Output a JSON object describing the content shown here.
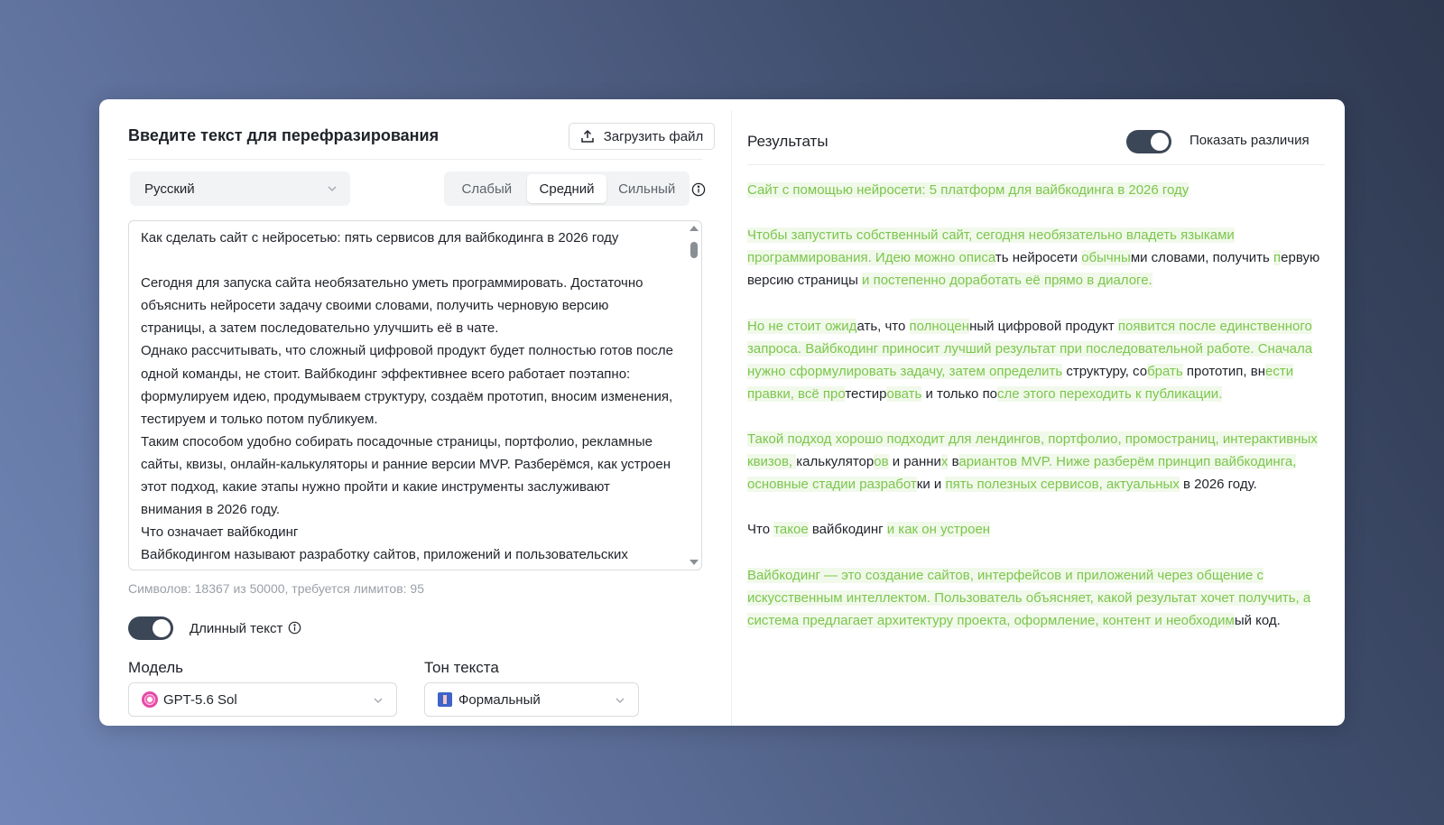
{
  "input": {
    "title": "Введите текст для перефразирования",
    "upload_label": "Загрузить файл",
    "language": "Русский",
    "strength_options": [
      "Слабый",
      "Средний",
      "Сильный"
    ],
    "strength_selected": "Средний",
    "text": "Как сделать сайт с нейросетью: пять сервисов для вайбкодинга в 2026 году\n\nСегодня для запуска сайта необязательно уметь программировать. Достаточно объяснить нейросети задачу своими словами, получить черновую версию страницы, а затем последовательно улучшить её в чате.\nОднако рассчитывать, что сложный цифровой продукт будет полностью готов после одной команды, не стоит. Вайбкодинг эффективнее всего работает поэтапно: формулируем идею, продумываем структуру, создаём прототип, вносим изменения, тестируем и только потом публикуем.\nТаким способом удобно собирать посадочные страницы, портфолио, рекламные сайты, квизы, онлайн-калькуляторы и ранние версии MVP. Разберёмся, как устроен этот подход, какие этапы нужно пройти и какие инструменты заслуживают внимания в 2026 году.\nЧто означает вайбкодинг\nВайбкодингом называют разработку сайтов, приложений и пользовательских",
    "char_count": "Символов: 18367 из 50000, требуется лимитов: 95",
    "long_text_label": "Длинный текст",
    "long_text_enabled": true,
    "model_label": "Модель",
    "model_value": "GPT-5.6 Sol",
    "tone_label": "Тон текста",
    "tone_value": "Формальный"
  },
  "results": {
    "title": "Результаты",
    "show_diff_label": "Показать различия",
    "show_diff_enabled": true,
    "paragraphs": [
      [
        [
          "Сайт с помощью нейросети: 5 платформ для вайбкодинга в 2026 году",
          true
        ]
      ],
      [
        [
          "Чтобы запустить собственный сайт, сегодня необязательно владеть языками программирования. Идею можно описа",
          true
        ],
        [
          "ть нейросети ",
          false
        ],
        [
          "обычны",
          true
        ],
        [
          "ми словами, получить ",
          false
        ],
        [
          "п",
          true
        ],
        [
          "ервую версию страницы ",
          false
        ],
        [
          "и постепенно доработать её прямо в диалоге.",
          true
        ]
      ],
      [
        [
          "Но не стоит ожид",
          true
        ],
        [
          "ать, что ",
          false
        ],
        [
          "полноцен",
          true
        ],
        [
          "ный цифровой продукт ",
          false
        ],
        [
          "появится после единственного запроса. Вайбкодинг приносит лучший результат при последовательной работе. Сначала нужно сформулировать задачу, затем определить",
          true
        ],
        [
          " структуру, со",
          false
        ],
        [
          "брать",
          true
        ],
        [
          " прототип, вн",
          false
        ],
        [
          "ести правки, всё про",
          true
        ],
        [
          "тестир",
          false
        ],
        [
          "овать",
          true
        ],
        [
          " и только по",
          false
        ],
        [
          "сле этого переходить к публикации.",
          true
        ]
      ],
      [
        [
          "Такой подход хорошо подходит для лендингов, портфолио, промостраниц, интерактивных квизов, ",
          true
        ],
        [
          "калькулятор",
          false
        ],
        [
          "ов",
          true
        ],
        [
          " и ранни",
          false
        ],
        [
          "х",
          true
        ],
        [
          " в",
          false
        ],
        [
          "ариантов MVP. Ниже разберём принцип вайбкодинга, основные стадии разработ",
          true
        ],
        [
          "ки и ",
          false
        ],
        [
          "пять полезных сервисов, актуальных",
          true
        ],
        [
          " в 2026 году.",
          false
        ]
      ],
      [
        [
          "Что ",
          false
        ],
        [
          "такое",
          true
        ],
        [
          " вайбкодинг ",
          false
        ],
        [
          "и как он устроен",
          true
        ]
      ],
      [
        [
          "Вайбкодинг — это создание сайтов, интерфейсов и приложений через общение с искусственным интеллектом. Пользователь объясняет, какой результат хочет получить, а система предлагает архитектуру проекта, оформление, контент и необходим",
          true
        ],
        [
          "ый код.",
          false
        ]
      ]
    ]
  }
}
